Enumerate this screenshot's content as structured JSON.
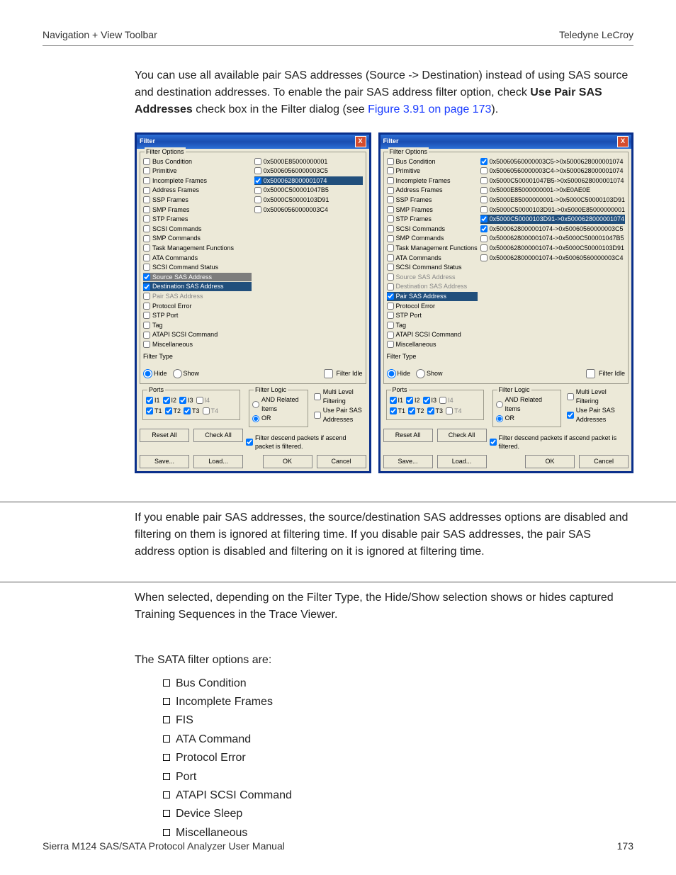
{
  "header": {
    "left": "Navigation + View Toolbar",
    "right": "Teledyne LeCroy"
  },
  "intro": {
    "p1a": "You can use all available pair SAS addresses (Source -> Destination) instead of using SAS source and destination addresses. To enable the pair SAS address filter option, check ",
    "p1bold": "Use Pair SAS Addresses",
    "p1b": " check box in the Filter dialog (see ",
    "xref": "Figure 3.91 on page 173",
    "p1c": ")."
  },
  "dialog_common": {
    "title": "Filter",
    "close": "X",
    "groupFilterOptions": "Filter Options",
    "options": [
      {
        "lbl": "Bus Condition",
        "chk": false
      },
      {
        "lbl": "Primitive",
        "chk": false
      },
      {
        "lbl": "Incomplete Frames",
        "chk": false
      },
      {
        "lbl": "Address Frames",
        "chk": false
      },
      {
        "lbl": "SSP Frames",
        "chk": false
      },
      {
        "lbl": "SMP Frames",
        "chk": false
      },
      {
        "lbl": "STP Frames",
        "chk": false
      },
      {
        "lbl": "SCSI Commands",
        "chk": false
      },
      {
        "lbl": "SMP Commands",
        "chk": false
      },
      {
        "lbl": "Task Management Functions",
        "chk": false
      },
      {
        "lbl": "ATA Commands",
        "chk": false
      },
      {
        "lbl": "SCSI Command Status",
        "chk": false
      }
    ],
    "options_src_dest": [
      {
        "lbl": "Source SAS Address",
        "cls": "sel-src",
        "chk": true
      },
      {
        "lbl": "Destination SAS Address",
        "cls": "sel-dest",
        "chk": true
      },
      {
        "lbl": "Pair SAS Address",
        "cls": "disabled",
        "chk": false
      }
    ],
    "options_pair": [
      {
        "lbl": "Source SAS Address",
        "cls": "disabled",
        "chk": false
      },
      {
        "lbl": "Destination SAS Address",
        "cls": "disabled",
        "chk": false
      },
      {
        "lbl": "Pair SAS Address",
        "cls": "sel-pair",
        "chk": true
      }
    ],
    "options_tail": [
      {
        "lbl": "Protocol Error",
        "chk": false
      },
      {
        "lbl": "STP Port",
        "chk": false
      },
      {
        "lbl": "Tag",
        "chk": false
      },
      {
        "lbl": "ATAPI SCSI Command",
        "chk": false
      },
      {
        "lbl": "Miscellaneous",
        "chk": false
      }
    ],
    "filterTypeLabel": "Filter Type",
    "ftHide": "Hide",
    "ftShow": "Show",
    "ftIdle": "Filter Idle",
    "groupPorts": "Ports",
    "portsI": [
      "I1",
      "I2",
      "I3",
      "I4"
    ],
    "portsT": [
      "T1",
      "T2",
      "T3",
      "T4"
    ],
    "resetAll": "Reset All",
    "checkAll": "Check All",
    "groupFilterLogic": "Filter Logic",
    "flAnd": "AND Related Items",
    "flOr": "OR",
    "flMulti": "Multi Level Filtering",
    "flUsePair": "Use Pair SAS Addresses",
    "flDescend": "Filter descend packets if ascend packet is filtered.",
    "save": "Save...",
    "load": "Load...",
    "ok": "OK",
    "cancel": "Cancel"
  },
  "left_addresses": [
    {
      "lbl": "0x5000E85000000001",
      "chk": false,
      "hl": false
    },
    {
      "lbl": "0x50060560000003C5",
      "chk": false,
      "hl": false
    },
    {
      "lbl": "0x5000628000001074",
      "chk": true,
      "hl": true
    },
    {
      "lbl": "0x5000C500001047B5",
      "chk": false,
      "hl": false
    },
    {
      "lbl": "0x5000C50000103D91",
      "chk": false,
      "hl": false
    },
    {
      "lbl": "0x50060560000003C4",
      "chk": false,
      "hl": false
    }
  ],
  "right_addresses": [
    {
      "lbl": "0x50060560000003C5->0x5000628000001074",
      "chk": true,
      "hl": false
    },
    {
      "lbl": "0x50060560000003C4->0x5000628000001074",
      "chk": false,
      "hl": false
    },
    {
      "lbl": "0x5000C500001047B5->0x5000628000001074",
      "chk": false,
      "hl": false
    },
    {
      "lbl": "0x5000E85000000001->0xE0AE0E",
      "chk": false,
      "hl": false
    },
    {
      "lbl": "0x5000E85000000001->0x5000C50000103D91",
      "chk": false,
      "hl": false
    },
    {
      "lbl": "0x5000C50000103D91->0x5000E85000000001",
      "chk": false,
      "hl": false
    },
    {
      "lbl": "0x5000C50000103D91->0x5000628000001074",
      "chk": true,
      "hl": true
    },
    {
      "lbl": "0x5000628000001074->0x50060560000003C5",
      "chk": true,
      "hl": false
    },
    {
      "lbl": "0x5000628000001074->0x5000C500001047B5",
      "chk": false,
      "hl": false
    },
    {
      "lbl": "0x5000628000001074->0x5000C50000103D91",
      "chk": false,
      "hl": false
    },
    {
      "lbl": "0x5000628000001074->0x50060560000003C4",
      "chk": false,
      "hl": false
    }
  ],
  "note": "If you enable pair SAS addresses, the source/destination SAS addresses options are disabled and filtering on them is ignored at filtering time. If you disable pair SAS addresses, the pair SAS address option is disabled and filtering on it is ignored at filtering time.",
  "post_note": "When selected, depending on the Filter Type, the Hide/Show selection shows or hides captured Training Sequences in the Trace Viewer.",
  "sata": {
    "intro": "The SATA filter options are:",
    "items": [
      "Bus Condition",
      "Incomplete Frames",
      "FIS",
      "ATA Command",
      "Protocol Error",
      "Port",
      "ATAPI SCSI Command",
      "Device Sleep",
      "Miscellaneous"
    ]
  },
  "footer": {
    "left": "Sierra M124 SAS/SATA Protocol Analyzer User Manual",
    "right": "173"
  }
}
